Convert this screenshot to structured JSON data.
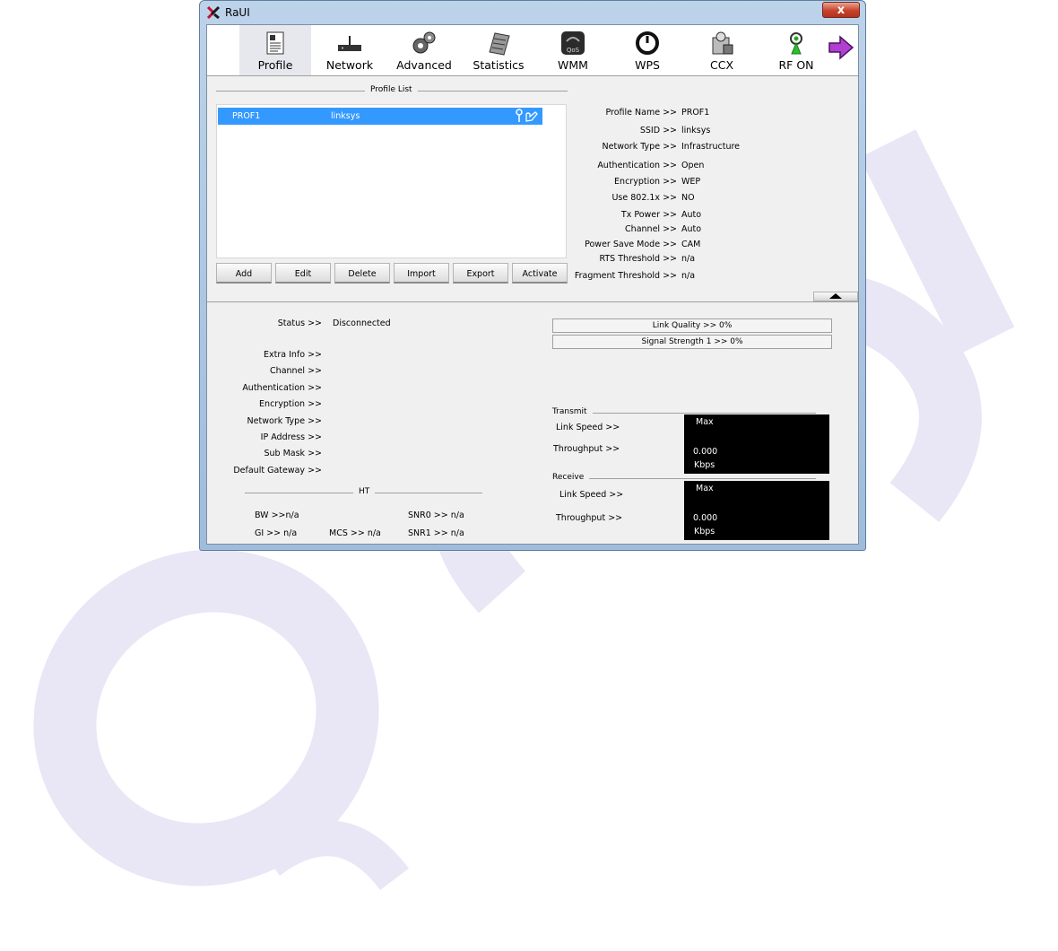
{
  "window": {
    "title": "RaUI",
    "close_label": "x"
  },
  "toolbar": {
    "items": [
      {
        "label": "Profile",
        "icon": "profile-icon",
        "active": true
      },
      {
        "label": "Network",
        "icon": "network-icon"
      },
      {
        "label": "Advanced",
        "icon": "advanced-icon"
      },
      {
        "label": "Statistics",
        "icon": "statistics-icon"
      },
      {
        "label": "WMM",
        "icon": "wmm-qos-icon"
      },
      {
        "label": "WPS",
        "icon": "wps-icon"
      },
      {
        "label": "CCX",
        "icon": "ccx-icon"
      },
      {
        "label": "RF ON",
        "icon": "rf-on-icon"
      }
    ],
    "next_icon": "arrow-right-icon"
  },
  "profile_list": {
    "title": "Profile List",
    "rows": [
      {
        "name": "PROF1",
        "ssid": "linksys"
      }
    ]
  },
  "buttons": {
    "add": "Add",
    "edit": "Edit",
    "delete": "Delete",
    "import": "Import",
    "export": "Export",
    "activate": "Activate"
  },
  "profile_details": [
    {
      "label": "Profile Name >>",
      "value": "PROF1"
    },
    {
      "label": "SSID >>",
      "value": "linksys"
    },
    {
      "label": "Network Type >>",
      "value": "Infrastructure"
    },
    {
      "label": "Authentication >>",
      "value": "Open"
    },
    {
      "label": "Encryption >>",
      "value": "WEP"
    },
    {
      "label": "Use 802.1x >>",
      "value": "NO"
    },
    {
      "label": "Tx Power >>",
      "value": "Auto"
    },
    {
      "label": "Channel >>",
      "value": "Auto"
    },
    {
      "label": "Power Save Mode >>",
      "value": "CAM"
    },
    {
      "label": "RTS Threshold >>",
      "value": "n/a"
    },
    {
      "label": "Fragment Threshold >>",
      "value": "n/a"
    }
  ],
  "status": {
    "status_label": "Status >>",
    "status_value": "Disconnected",
    "fields": [
      "Extra Info >>",
      "Channel >>",
      "Authentication >>",
      "Encryption >>",
      "Network Type >>",
      "IP Address >>",
      "Sub Mask >>",
      "Default Gateway >>"
    ]
  },
  "ht": {
    "title": "HT",
    "bw": "BW >>n/a",
    "gi": "GI >> n/a",
    "mcs": "MCS >> n/a",
    "snr0": "SNR0 >>  n/a",
    "snr1": "SNR1 >>  n/a"
  },
  "quality": {
    "link_quality": "Link Quality >> 0%",
    "link_quality_pct": 0,
    "signal_strength": "Signal Strength 1 >> 0%",
    "signal_strength_pct": 0
  },
  "transmit": {
    "title": "Transmit",
    "link_speed_label": "Link Speed >>",
    "throughput_label": "Throughput >>",
    "max": "Max",
    "value": "0.000",
    "unit": "Kbps"
  },
  "receive": {
    "title": "Receive",
    "link_speed_label": "Link Speed >>",
    "throughput_label": "Throughput >>",
    "max": "Max",
    "value": "0.000",
    "unit": "Kbps"
  },
  "colors": {
    "selection": "#3399ff",
    "watermark": "#e8e5f7",
    "meter_bg": "#000000"
  }
}
